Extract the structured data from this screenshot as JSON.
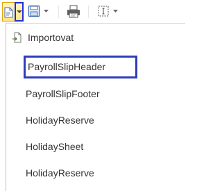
{
  "toolbar": {
    "buttons": [
      {
        "name": "import-split-button",
        "icon": "import-icon",
        "active": true
      },
      {
        "name": "save-button",
        "icon": "save-icon"
      },
      {
        "name": "print-button",
        "icon": "print-icon"
      },
      {
        "name": "select-area-button",
        "icon": "select-area-icon"
      }
    ],
    "accent_color": "#2e3cbe",
    "active_bg_color": "#ffe28a"
  },
  "menu": {
    "items": [
      {
        "label": "Importovat",
        "icon": "import-file-icon"
      },
      {
        "label": "PayrollSlipHeader",
        "highlighted": true
      },
      {
        "label": "PayrollSlipFooter"
      },
      {
        "label": "HolidayReserve"
      },
      {
        "label": "HolidaySheet"
      },
      {
        "label": "HolidayReserve"
      }
    ]
  }
}
